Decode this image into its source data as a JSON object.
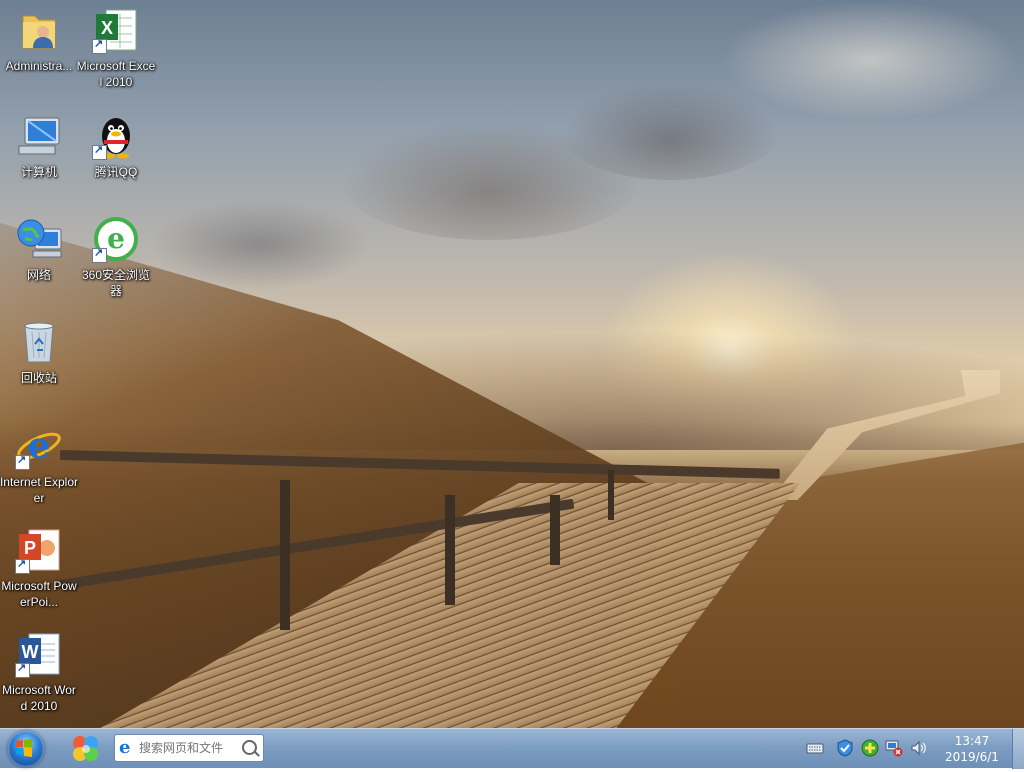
{
  "desktop": {
    "icons": [
      {
        "label": "Administra...",
        "icon": "user-folder-icon"
      },
      {
        "label": "Microsoft Excel 2010",
        "icon": "excel-icon"
      },
      {
        "label": "计算机",
        "icon": "computer-icon"
      },
      {
        "label": "腾讯QQ",
        "icon": "qq-penguin-icon"
      },
      {
        "label": "网络",
        "icon": "network-globe-icon"
      },
      {
        "label": "360安全浏览器",
        "icon": "360-browser-icon"
      },
      {
        "label": "回收站",
        "icon": "recycle-bin-icon"
      },
      {
        "label": "Internet Explorer",
        "icon": "ie-icon"
      },
      {
        "label": "Microsoft PowerPoi...",
        "icon": "powerpoint-icon"
      },
      {
        "label": "Microsoft Word 2010",
        "icon": "word-icon"
      }
    ]
  },
  "taskbar": {
    "search_placeholder": "搜索网页和文件",
    "pinned": [
      "multicolor-app-icon"
    ],
    "tray_icons": [
      "keyboard-icon",
      "shield-check-icon",
      "green-plus-icon",
      "network-error-icon",
      "volume-icon"
    ],
    "clock": {
      "time": "13:47",
      "date": "2019/6/1"
    }
  },
  "colors": {
    "taskbar_top": "#9cb6d4",
    "taskbar_bottom": "#6e90b7",
    "ie_blue": "#1e6fd1",
    "excel_green": "#1f7a3a",
    "ppt_orange": "#d24726",
    "word_blue": "#2b579a"
  }
}
